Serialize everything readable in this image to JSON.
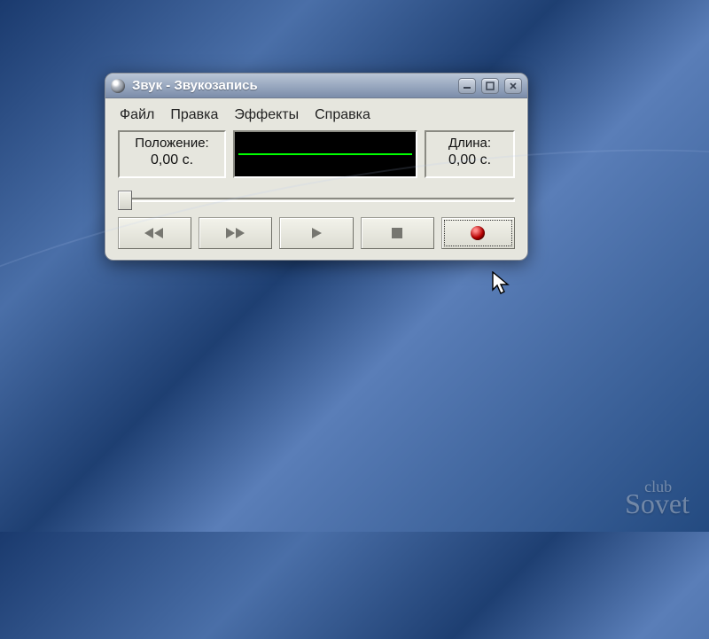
{
  "titlebar": {
    "title": "Звук - Звукозапись"
  },
  "menu": {
    "file": "Файл",
    "edit": "Правка",
    "effects": "Эффекты",
    "help": "Справка"
  },
  "position": {
    "label": "Положение:",
    "value": "0,00 с."
  },
  "length": {
    "label": "Длина:",
    "value": "0,00 с."
  },
  "watermark": {
    "top": "club",
    "bottom": "Sovet"
  }
}
